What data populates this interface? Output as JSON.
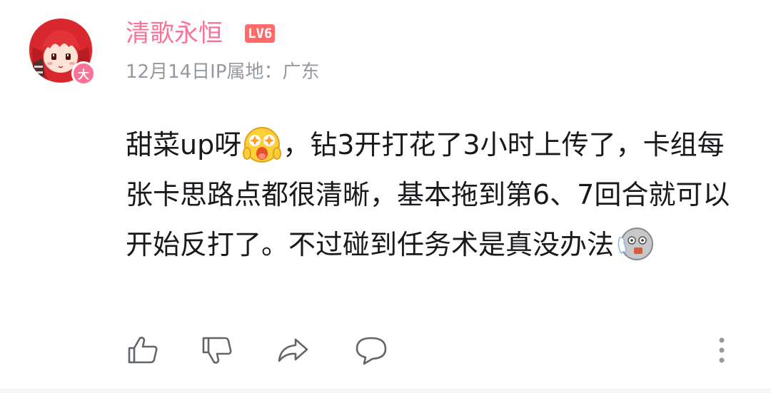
{
  "user": {
    "name": "清歌永恒",
    "level": "LV6",
    "badge_text": "大"
  },
  "meta": {
    "date": "12月14日",
    "ip_location": "IP属地：广东"
  },
  "comment": {
    "part1": "甜菜up呀",
    "part2": "，钻3开打花了3小时上传了，卡组每张卡思路点都很清晰，基本拖到第6、7回合就可以开始反打了。不过碰到任务术是真没办法",
    "emoji1": "surprised-starry-eyes-emoji",
    "emoji2": "speechless-ghost-emoji"
  },
  "actions": {
    "like": "thumbs-up-icon",
    "dislike": "thumbs-down-icon",
    "share": "share-icon",
    "reply": "comment-icon",
    "more": "more-vertical-icon"
  },
  "colors": {
    "username": "#fb7299",
    "level_badge": "#ff6b6b",
    "meta_text": "#9499a0",
    "body_text": "#18191c",
    "icon": "#61666d"
  }
}
